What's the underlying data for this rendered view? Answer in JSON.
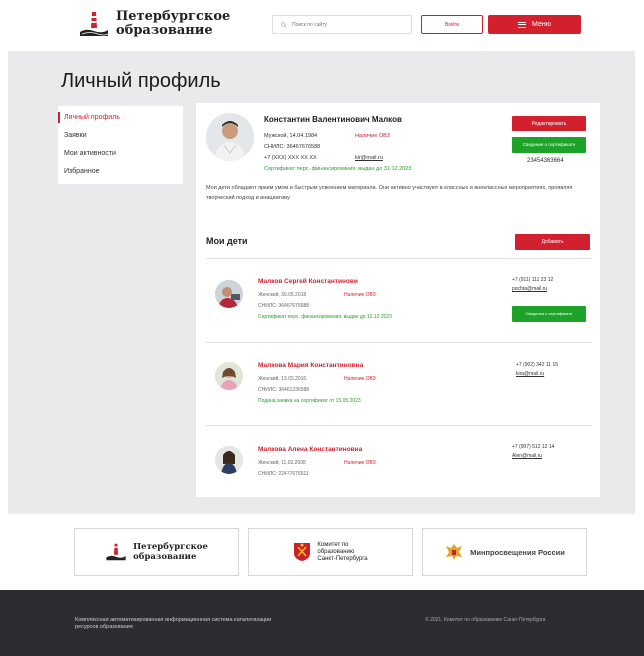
{
  "header": {
    "logo_line1": "Петербургское",
    "logo_line2": "образование",
    "search_placeholder": "Поиск по сайту",
    "login_label": "Войти",
    "menu_label": "Меню"
  },
  "page_title": "Личный профиль",
  "sidebar": {
    "items": [
      {
        "label": "Личный профиль",
        "active": true
      },
      {
        "label": "Заявки",
        "active": false
      },
      {
        "label": "Мои активности",
        "active": false
      },
      {
        "label": "Избранное",
        "active": false
      }
    ]
  },
  "profile": {
    "name": "Константин Валентинович Малков",
    "gender_dob": "Мужской, 14.04.1984",
    "ovz": "Наличие ОВЗ",
    "snils": "СНИЛС: 36467676588",
    "phone": "+7 (XXX) XXX XX XX",
    "email": "kir@mail.ru",
    "certificate": "Сертификат перс. финансирования: выдан до 31.12.2023",
    "edit_button": "Редактировать",
    "cert_button": "Сведения о сертификате",
    "cert_number": "23454363664",
    "about": "Мои дети обладают ярким умом и быстрым усвоением материала. Они активно участвуют в классных и внеклассных мероприятиях, проявляя творческий подход и инициативу."
  },
  "children": {
    "title": "Мои дети",
    "add_button": "Добавить",
    "list": [
      {
        "name": "Малков Сергей Константинови",
        "gender_dob": "Женский, 30.05.2018",
        "ovz": "Наличие ОВЗ",
        "snils": "СНИЛС: 36467676588",
        "status": "Сертификат перс. финансирования: выдан до 12.12.2023",
        "phone": "+7 (911) 111 23 12",
        "email": "pochta@mail.ru",
        "cert_button": "Сведения о сертификате"
      },
      {
        "name": "Малкова Мария Константиновна",
        "gender_dob": "Женский, 13.03.2016",
        "ovz": "Наличие ОВЗ",
        "snils": "СНИЛС: 36461236588",
        "status": "Подана заявка на сертификат от 15.05.2023",
        "phone": "+7 (902) 342 11 15",
        "email": "kira@mail.ru"
      },
      {
        "name": "Малкова Алена Константиновна",
        "gender_dob": "Женский, 11.02.2008",
        "ovz": "Наличие ОВЗ",
        "snils": "СНИЛС: 22477676511",
        "phone": "+7 (907) 512 12 14",
        "email": "Alen@mail.ru"
      }
    ]
  },
  "partners": {
    "p1_line1": "Петербургское",
    "p1_line2": "образование",
    "p2_line1": "Комитет по",
    "p2_line2": "образованию",
    "p2_line3": "Санкт-Петербурга",
    "p3_name": "Минпросвещения России"
  },
  "footer": {
    "left": "Комплексная автоматизированная информационная система каталогизации ресурсов образования",
    "right": "© 2021. Комитет по образованию Санкт-Петербурга"
  },
  "colors": {
    "accent_red": "#d3202e",
    "green": "#1ea22a",
    "footer_bg": "#2c2d31",
    "page_bg": "#eaeaec"
  }
}
